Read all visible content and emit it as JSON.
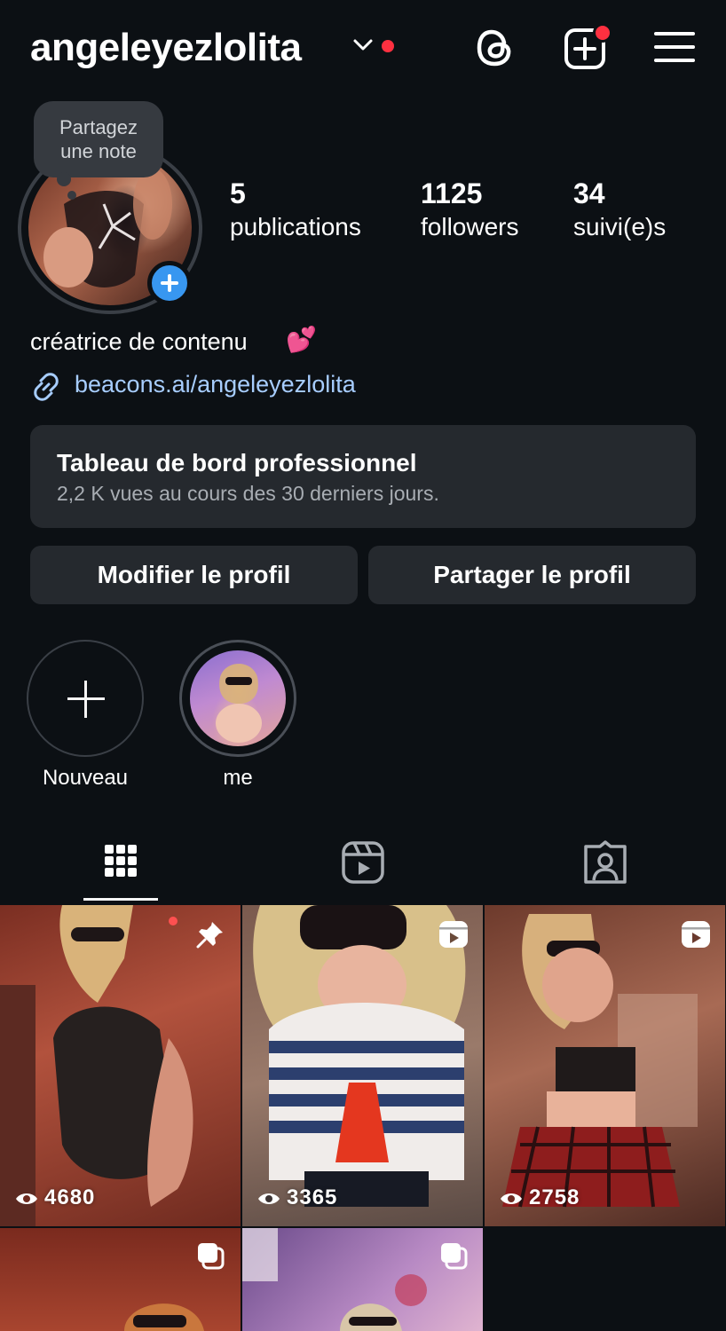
{
  "header": {
    "username": "angeleyezlolita",
    "icons": [
      "chevron-down-icon",
      "threads-icon",
      "create-post-icon",
      "menu-icon"
    ],
    "notification_color": "#ff3040"
  },
  "note": {
    "text_line1": "Partagez",
    "text_line2": "une note"
  },
  "stats": [
    {
      "count": "5",
      "label": "publications"
    },
    {
      "count": "1125",
      "label": "followers"
    },
    {
      "count": "34",
      "label": "suivi(e)s"
    }
  ],
  "bio": {
    "text": "créatrice de contenu",
    "emoji": "💕"
  },
  "link": {
    "url": "beacons.ai/angeleyezlolita",
    "color": "#a7cdff"
  },
  "dashboard": {
    "title": "Tableau de bord professionnel",
    "subtitle": "2,2 K vues au cours des 30 derniers jours."
  },
  "buttons": {
    "edit": "Modifier le profil",
    "share": "Partager le profil"
  },
  "highlights": [
    {
      "label": "Nouveau",
      "icon": "plus-icon"
    },
    {
      "label": "me"
    }
  ],
  "tabs": [
    "grid-icon",
    "reels-icon",
    "tagged-icon"
  ],
  "posts": [
    {
      "views": "4680",
      "badge": "pin-icon"
    },
    {
      "views": "3365",
      "badge": "reel-icon"
    },
    {
      "views": "2758",
      "badge": "reel-icon"
    },
    {
      "badge": "carousel-icon"
    },
    {
      "badge": "carousel-icon"
    }
  ],
  "colors": {
    "background": "#0c1014",
    "surface": "#25292e",
    "accent": "#3897f0"
  }
}
